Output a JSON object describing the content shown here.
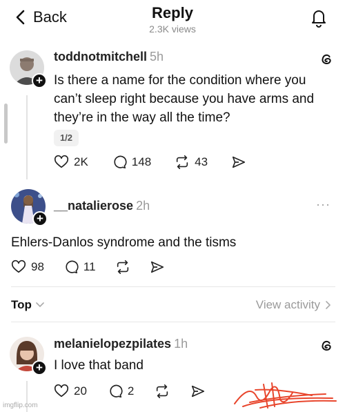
{
  "header": {
    "back_label": "Back",
    "title": "Reply",
    "views": "2.3K views"
  },
  "posts": [
    {
      "username": "toddnotmitchell",
      "time": "5h",
      "text": "Is there a name for the condition where you can’t sleep right because you have arms and they’re in the way all the time?",
      "page_indicator": "1/2",
      "likes": "2K",
      "comments": "148",
      "reposts": "43"
    },
    {
      "username": "__natalierose",
      "time": "2h",
      "text": "Ehlers-Danlos syndrome and the tisms",
      "likes": "98",
      "comments": "11"
    },
    {
      "username": "melanielopezpilates",
      "time": "1h",
      "text": "I love that band",
      "likes": "20",
      "comments": "2"
    }
  ],
  "sort": {
    "selected": "Top",
    "view_activity": "View activity"
  },
  "watermark": "imgflip.com",
  "colors": {
    "text": "#111111",
    "muted": "#9a9a9a",
    "scribble": "#e8452c"
  },
  "icons": [
    "chevron-left-icon",
    "bell-icon",
    "threads-icon",
    "heart-icon",
    "comment-icon",
    "repost-icon",
    "share-icon",
    "more-icon",
    "chevron-down-icon",
    "chevron-right-icon",
    "plus-icon"
  ]
}
